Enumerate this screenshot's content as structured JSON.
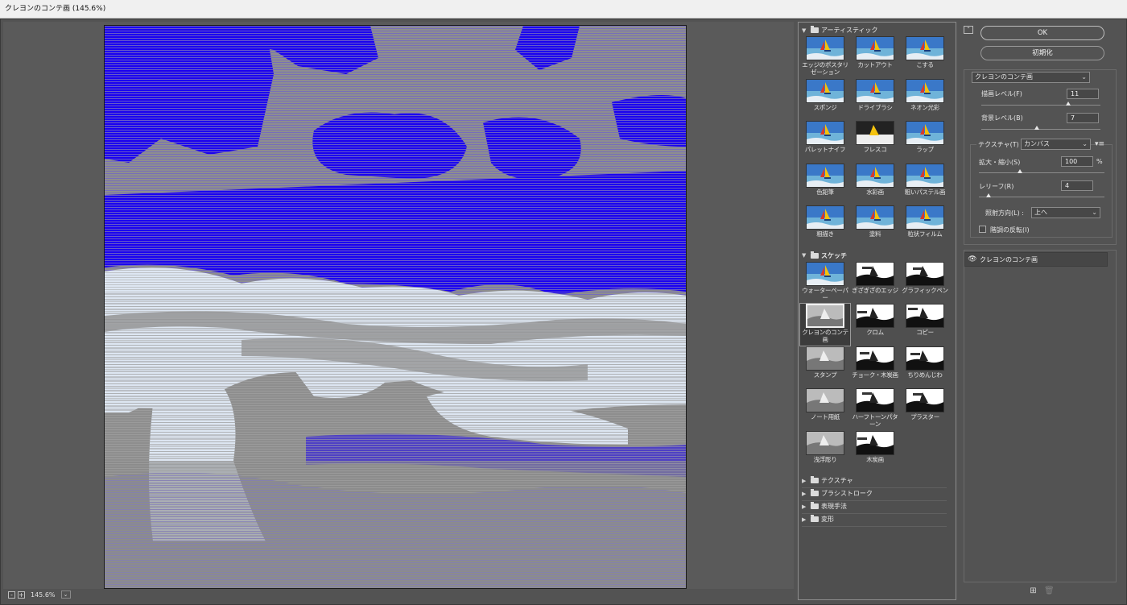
{
  "window": {
    "title": "クレヨンのコンテ画 (145.6%)"
  },
  "status": {
    "zoom": "145.6%",
    "zoom_out": "-",
    "zoom_in": "+",
    "dropdown": "⌄"
  },
  "gallery": {
    "groups": [
      {
        "name": "アーティスティック",
        "expanded": true,
        "filters": [
          "エッジのポスタリゼーション",
          "カットアウト",
          "こする",
          "スポンジ",
          "ドライブラシ",
          "ネオン光彩",
          "パレットナイフ",
          "フレスコ",
          "ラップ",
          "色鉛筆",
          "水彩画",
          "粗いパステル画",
          "粗描き",
          "塗料",
          "粒状フィルム"
        ]
      },
      {
        "name": "スケッチ",
        "expanded": true,
        "filters": [
          "ウォーターペーパー",
          "ぎざぎざのエッジ",
          "グラフィックペン",
          "クレヨンのコンテ画",
          "クロム",
          "コピー",
          "スタンプ",
          "チョーク・木炭画",
          "ちりめんじわ",
          "ノート用紙",
          "ハーフトーンパターン",
          "プラスター",
          "浅浮彫り",
          "木炭画"
        ],
        "selected": "クレヨンのコンテ画"
      },
      {
        "name": "テクスチャ",
        "expanded": false
      },
      {
        "name": "ブラシストローク",
        "expanded": false
      },
      {
        "name": "表現手法",
        "expanded": false
      },
      {
        "name": "変形",
        "expanded": false
      }
    ]
  },
  "buttons": {
    "ok": "OK",
    "reset": "初期化",
    "collapse": "⌃"
  },
  "settings": {
    "filter_select": "クレヨンのコンテ画",
    "foreground_label": "描画レベル(F)",
    "foreground_value": "11",
    "foreground_level": 0.733,
    "background_label": "背景レベル(B)",
    "background_value": "7",
    "background_level": 0.467,
    "texture_label": "テクスチャ(T) :",
    "texture_value": "カンバス",
    "scale_label": "拡大・縮小(S)",
    "scale_value": "100",
    "scale_unit": "%",
    "scale_level": 0.33,
    "relief_label": "レリーフ(R)",
    "relief_value": "4",
    "relief_level": 0.08,
    "light_label": "照射方向(L) :",
    "light_value": "上へ",
    "invert_label": "階調の反転(I)",
    "invert_checked": false
  },
  "layers": {
    "items": [
      {
        "name": "クレヨンのコンテ画",
        "visible": true
      }
    ],
    "new_icon": "⊞",
    "delete_icon": "🗑"
  },
  "colors": {
    "accent_blue": "#1a00f0",
    "paper_light": "#dde6f2",
    "gray": "#8e8e8e"
  }
}
